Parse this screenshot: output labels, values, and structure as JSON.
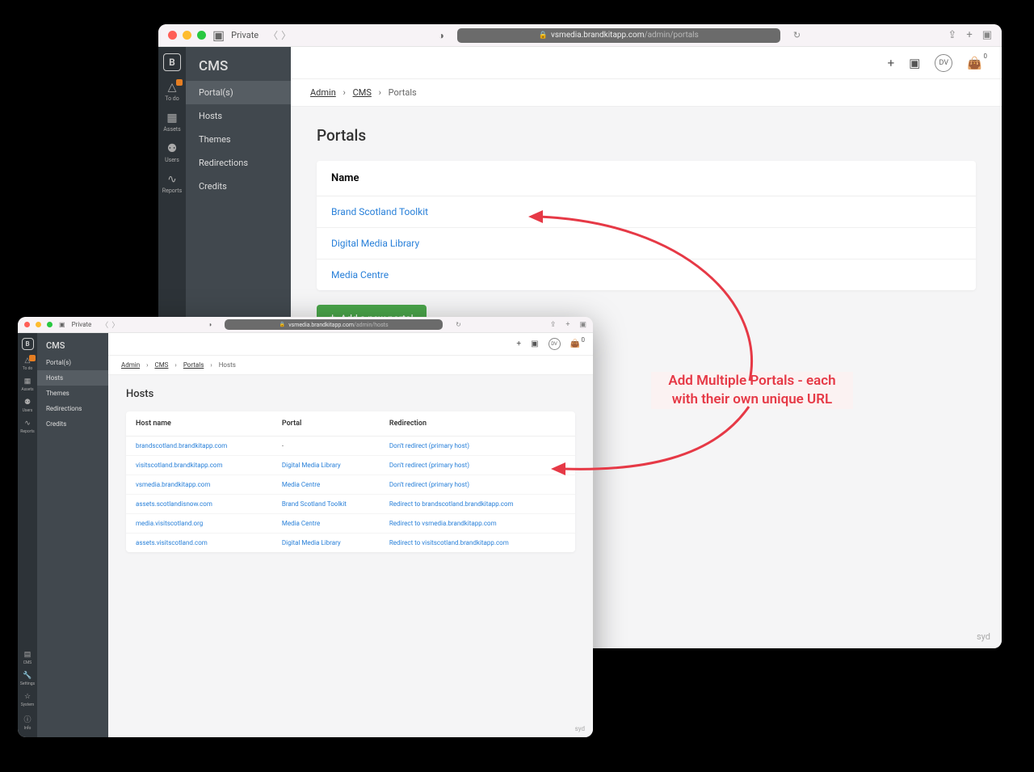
{
  "browser": {
    "private_label": "Private",
    "url_host": "vsmedia.brandkitapp.com",
    "url_path1": "/admin/portals",
    "url_path2": "/admin/hosts"
  },
  "rail": {
    "items": [
      {
        "label": "To do"
      },
      {
        "label": "Assets"
      },
      {
        "label": "Users"
      },
      {
        "label": "Reports"
      }
    ],
    "bottom": [
      {
        "label": "CMS"
      },
      {
        "label": "Settings"
      },
      {
        "label": "System"
      },
      {
        "label": "Info"
      }
    ]
  },
  "sidebar": {
    "title": "CMS",
    "items": [
      "Portal(s)",
      "Hosts",
      "Themes",
      "Redirections",
      "Credits"
    ]
  },
  "topbar": {
    "avatar_initials": "DV",
    "bag_count": "0"
  },
  "breadcrumb1": {
    "admin": "Admin",
    "cms": "CMS",
    "portals": "Portals"
  },
  "breadcrumb2": {
    "admin": "Admin",
    "cms": "CMS",
    "portals": "Portals",
    "hosts": "Hosts"
  },
  "portals_page": {
    "title": "Portals",
    "col_name": "Name",
    "rows": [
      "Brand Scotland Toolkit",
      "Digital Media Library",
      "Media Centre"
    ],
    "add_button": "Add a new portal"
  },
  "hosts_page": {
    "title": "Hosts",
    "cols": {
      "host": "Host name",
      "portal": "Portal",
      "redir": "Redirection"
    },
    "rows": [
      {
        "host": "brandscotland.brandkitapp.com",
        "portal": "-",
        "redir": "Don't redirect (primary host)"
      },
      {
        "host": "visitscotland.brandkitapp.com",
        "portal": "Digital Media Library",
        "redir": "Don't redirect (primary host)"
      },
      {
        "host": "vsmedia.brandkitapp.com",
        "portal": "Media Centre",
        "redir": "Don't redirect (primary host)"
      },
      {
        "host": "assets.scotlandisnow.com",
        "portal": "Brand Scotland Toolkit",
        "redir": "Redirect to brandscotland.brandkitapp.com"
      },
      {
        "host": "media.visitscotland.org",
        "portal": "Media Centre",
        "redir": "Redirect to vsmedia.brandkitapp.com"
      },
      {
        "host": "assets.visitscotland.com",
        "portal": "Digital Media Library",
        "redir": "Redirect to visitscotland.brandkitapp.com"
      }
    ]
  },
  "annotation": {
    "line1": "Add Multiple Portals - each",
    "line2": "with their own unique URL"
  },
  "footer": "syd"
}
